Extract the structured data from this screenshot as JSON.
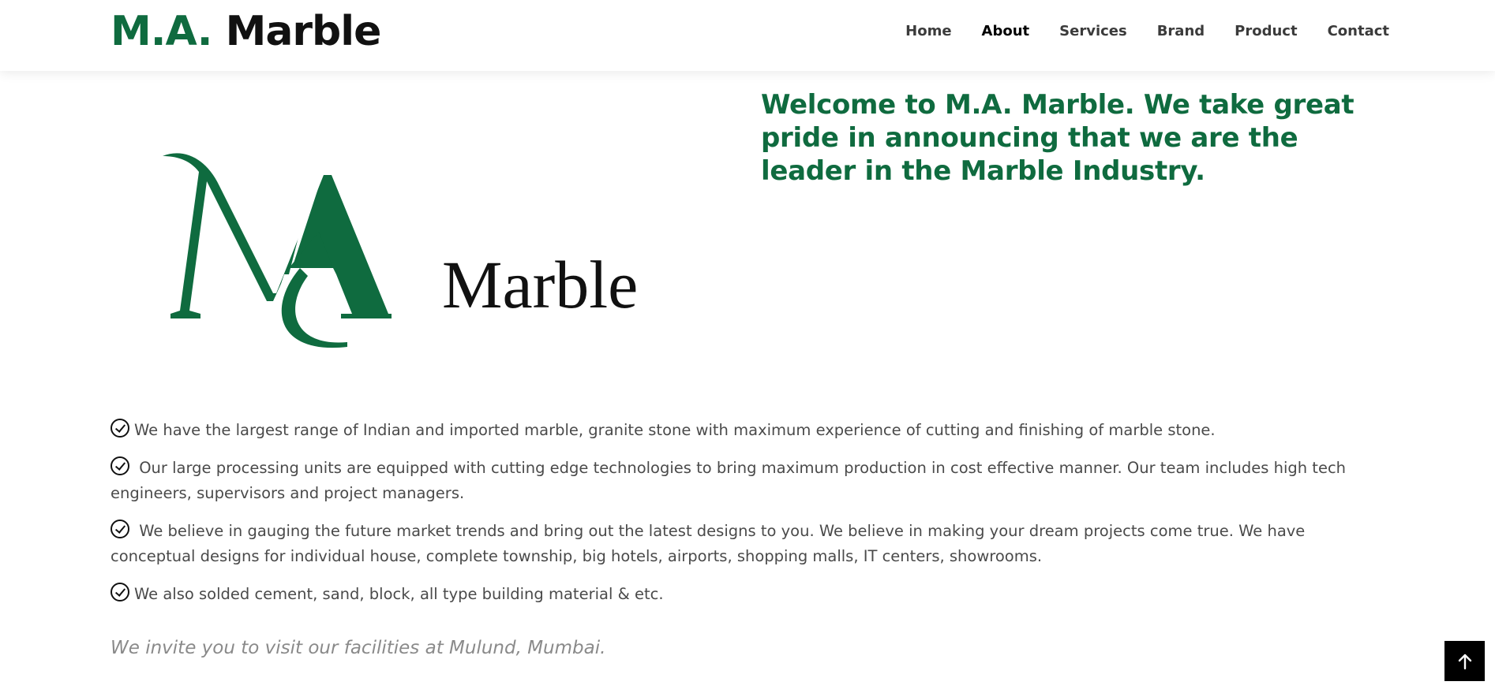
{
  "header": {
    "brand_accent": "M.A.",
    "brand_name": "Marble",
    "nav": [
      {
        "label": "Home"
      },
      {
        "label": "About"
      },
      {
        "label": "Services"
      },
      {
        "label": "Brand"
      },
      {
        "label": "Product"
      },
      {
        "label": "Contact"
      }
    ],
    "active_nav": "About"
  },
  "logo": {
    "wordmark": "Marble"
  },
  "intro": {
    "headline": "Welcome to M.A. Marble. We take great pride in announcing that we are the leader in the Marble Industry."
  },
  "features": [
    {
      "text": "We have the largest range of Indian and imported marble, granite stone with maximum experience of cutting and finishing of marble stone.",
      "icon": "check-circle-icon"
    },
    {
      "text": " Our large processing units are equipped with cutting edge technologies to bring maximum production in cost effective manner. Our team includes high tech engineers, supervisors and project managers.",
      "icon": "check-circle-icon"
    },
    {
      "text": " We believe in gauging the future market trends and bring out the latest designs to you. We believe in making your dream projects come true. We have conceptual designs for individual house, complete township, big hotels, airports, shopping malls, IT centers, showrooms.",
      "icon": "check-circle-icon"
    },
    {
      "text": "We also solded cement, sand, block, all type building material & etc.",
      "icon": "check-circle-icon"
    }
  ],
  "invite": "We invite you to visit our facilities at Mulund, Mumbai.",
  "back_to_top": {
    "icon": "arrow-up-icon"
  },
  "colors": {
    "brand_green": "#0f6b3f",
    "text": "#4a4a4a",
    "muted": "#8a8a8a"
  }
}
